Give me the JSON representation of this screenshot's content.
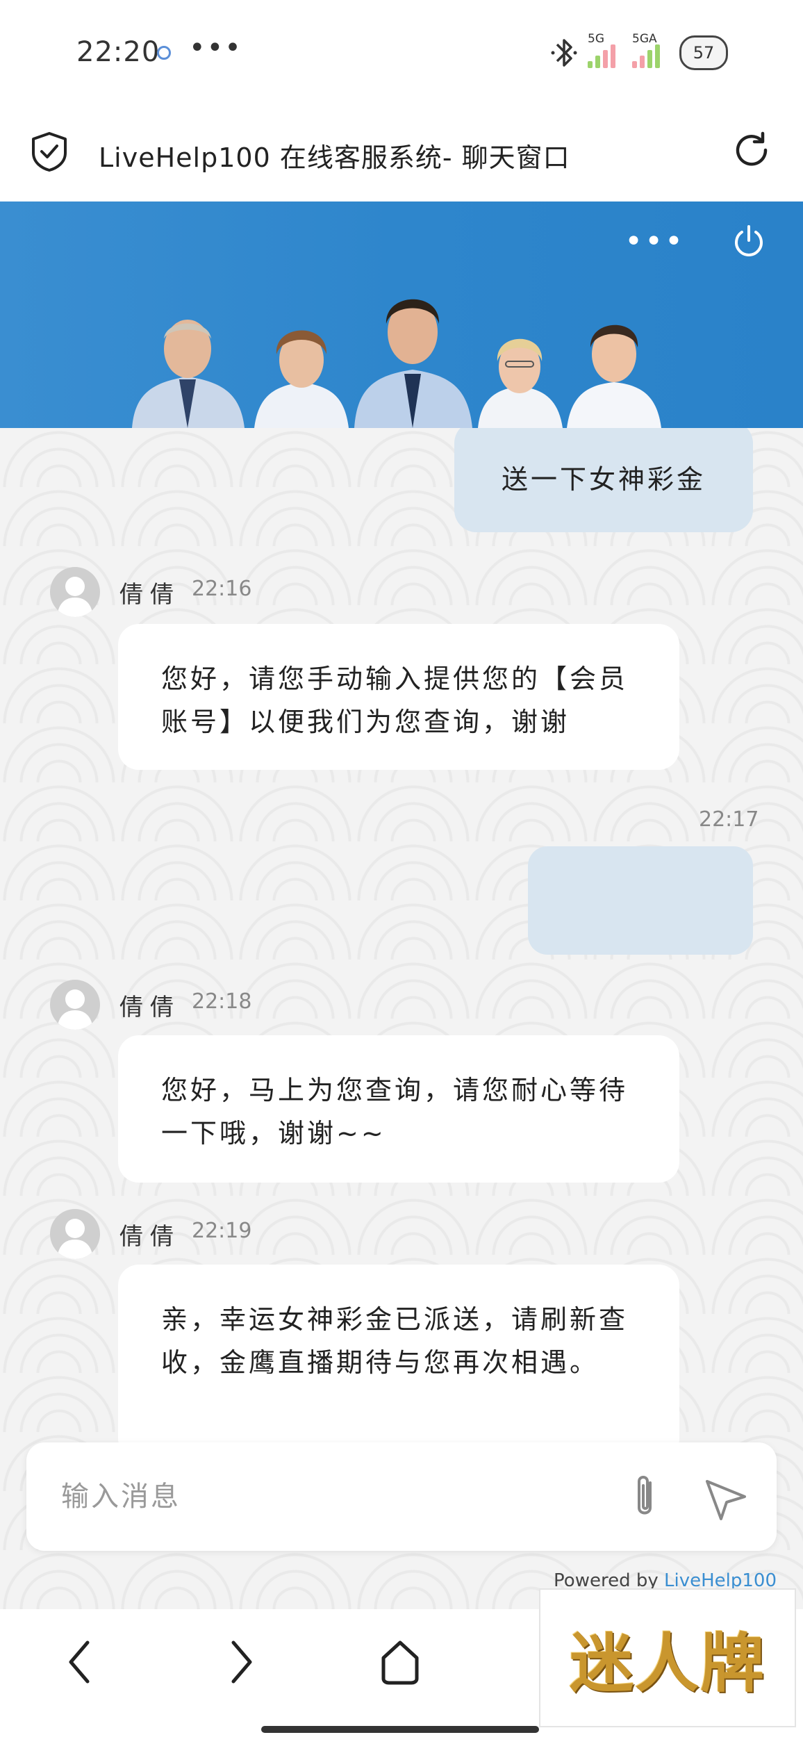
{
  "status_bar": {
    "time": "22:20",
    "more": "•••",
    "signal1_label": "5G",
    "signal2_label": "5GA",
    "battery": "57"
  },
  "browser": {
    "page_title": "LiveHelp100 在线客服系统- 聊天窗口"
  },
  "chat_header": {
    "more": "•••"
  },
  "messages": [
    {
      "side": "right",
      "text": "送一下女神彩金"
    },
    {
      "side": "left",
      "agent": "倩倩",
      "time": "22:16",
      "text": "您好，请您手动输入提供您的【会员账号】以便我们为您查询，谢谢"
    },
    {
      "side": "right",
      "time": "22:17",
      "text": ""
    },
    {
      "side": "left",
      "agent": "倩倩",
      "time": "22:18",
      "text": "您好，马上为您查询，请您耐心等待一下哦，谢谢~~"
    },
    {
      "side": "left",
      "agent": "倩倩",
      "time": "22:19",
      "text": "亲，幸运女神彩金已派送，请刷新查收，金鹰直播期待与您再次相遇。"
    }
  ],
  "input": {
    "placeholder": "输入消息",
    "value": ""
  },
  "powered_by": {
    "prefix": "Powered by",
    "link": "LiveHelp100"
  },
  "brand_stamp": "迷人牌",
  "colors": {
    "banner_blue": "#2e86cc",
    "customer_bubble": "#d8e5f0",
    "agent_bubble": "#ffffff",
    "chat_background": "#f3f3f3",
    "link": "#3a8ed1"
  },
  "icons": [
    "bluetooth-icon",
    "battery-icon",
    "shield-check-icon",
    "reload-icon",
    "power-icon",
    "avatar-icon",
    "paperclip-icon",
    "send-icon",
    "back-icon",
    "forward-icon",
    "home-icon"
  ]
}
